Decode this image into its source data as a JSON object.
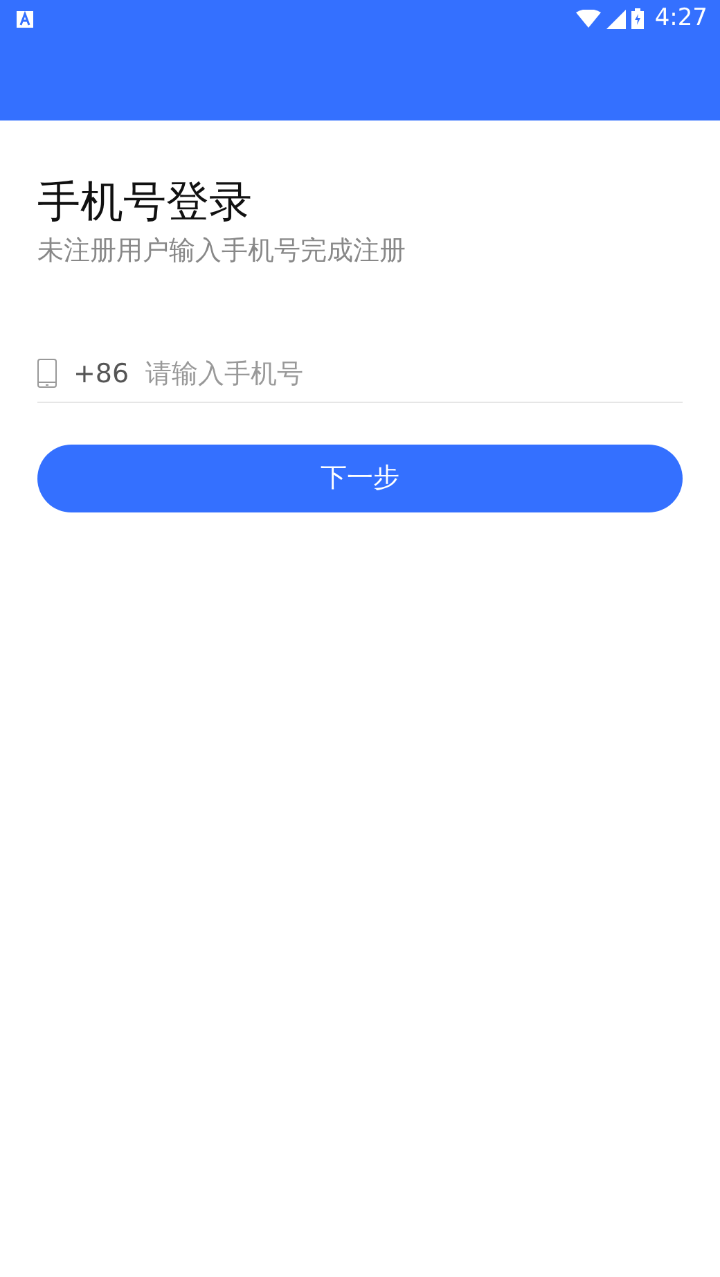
{
  "status_bar": {
    "time": "4:27"
  },
  "title": "手机号登录",
  "subtitle": "未注册用户输入手机号完成注册",
  "phone_field": {
    "country_code": "+86",
    "placeholder": "请输入手机号"
  },
  "next_button": {
    "label": "下一步"
  }
}
